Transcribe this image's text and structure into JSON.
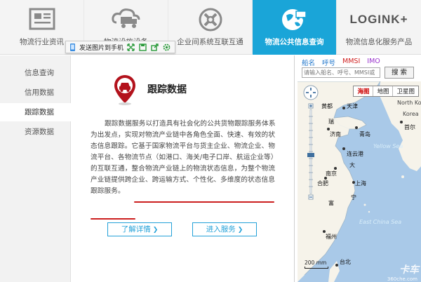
{
  "nav": {
    "tabs": [
      {
        "label": "物流行业资讯"
      },
      {
        "label": "物流设施设备"
      },
      {
        "label": "企业间系统互联互通"
      },
      {
        "label": "物流公共信息查询"
      },
      {
        "label": "物流信息化服务产品"
      }
    ],
    "logo_text": "LOGINK+",
    "active_tab": "物流公共信息查询"
  },
  "floatbar": {
    "send_label": "发送图片到手机"
  },
  "sidebar": {
    "items": [
      {
        "label": "信息查询"
      },
      {
        "label": "信用数据"
      },
      {
        "label": "跟踪数据"
      },
      {
        "label": "资源数据"
      }
    ],
    "active": "跟踪数据"
  },
  "main": {
    "title": "跟踪数据",
    "description": "跟踪数据服务以打造具有社会化的公共货物跟踪服务体系为出发点，实现对物流产业链中各角色全面、快速、有效的状态信息跟踪。它基于国家物流平台与货主企业、物流企业、物流平台、各物流节点（如港口、海关/电子口岸、航运企业等）的互联互通，整合物流产业链上的物流状态信息，为整个物流产业链提供跨企业、跨运输方式、个性化、多维度的状态信息跟踪服务。",
    "learn_more": "了解详情",
    "enter_service": "进入服务"
  },
  "map": {
    "options": [
      {
        "label": "船名",
        "color": "#2277cc"
      },
      {
        "label": "呼号",
        "color": "#2277cc"
      },
      {
        "label": "MMSI",
        "color": "#d02020"
      },
      {
        "label": "IMO",
        "color": "#9933cc"
      }
    ],
    "search_placeholder": "请输入船名、呼号、MMSI或",
    "search_button": "搜 索",
    "types": [
      "海图",
      "地图",
      "卫星图"
    ],
    "selected_type": "海图",
    "places": {
      "huangdu": "黄都",
      "north_korea": "North Korea",
      "korea": "Korea",
      "seoul": "首尔",
      "rui": "瑞",
      "tianjin": "天津",
      "jinan": "济南",
      "qingdao": "青岛",
      "lianyungang": "连云港",
      "yellow_sea": "Yellow Sea",
      "dazhi": "大",
      "nanjing": "南京",
      "shanghai": "上海",
      "hefei": "合肥",
      "fuhao": "富",
      "ning": "宁",
      "east_china_sea": "East China Sea",
      "fuzhou": "福州",
      "taibei": "台北"
    },
    "scale_label": "200 mm",
    "watermark": "卡车",
    "watermark_url": "360che.com"
  }
}
